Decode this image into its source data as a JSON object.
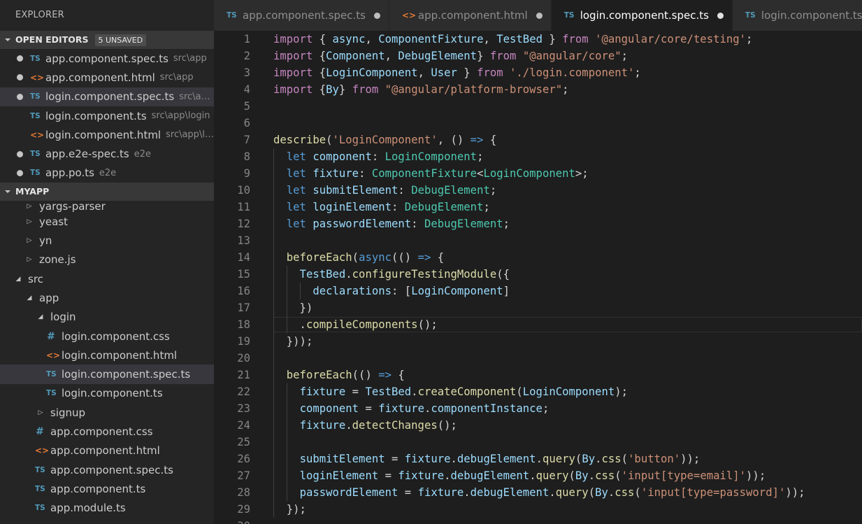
{
  "sidebar": {
    "title": "EXPLORER",
    "open_editors": {
      "label": "OPEN EDITORS",
      "badge": "5 UNSAVED",
      "items": [
        {
          "name": "app.component.spec.ts",
          "path": "src\\app",
          "type": "ts",
          "unsaved": true
        },
        {
          "name": "app.component.html",
          "path": "src\\app",
          "type": "html",
          "unsaved": true
        },
        {
          "name": "login.component.spec.ts",
          "path": "src\\app...",
          "type": "ts",
          "unsaved": true
        },
        {
          "name": "login.component.ts",
          "path": "src\\app\\login",
          "type": "ts",
          "unsaved": false
        },
        {
          "name": "login.component.html",
          "path": "src\\app\\lo...",
          "type": "html",
          "unsaved": false
        },
        {
          "name": "app.e2e-spec.ts",
          "path": "e2e",
          "type": "ts",
          "unsaved": true
        },
        {
          "name": "app.po.ts",
          "path": "e2e",
          "type": "ts",
          "unsaved": true
        }
      ]
    },
    "myapp": {
      "label": "MYAPP",
      "tree": [
        {
          "name": "yargs-parser",
          "kind": "folder",
          "expanded": false,
          "depth": 0
        },
        {
          "name": "yeast",
          "kind": "folder",
          "expanded": false,
          "depth": 0
        },
        {
          "name": "yn",
          "kind": "folder",
          "expanded": false,
          "depth": 0
        },
        {
          "name": "zone.js",
          "kind": "folder",
          "expanded": false,
          "depth": 0
        },
        {
          "name": "src",
          "kind": "folder",
          "expanded": true,
          "depth": -1
        },
        {
          "name": "app",
          "kind": "folder",
          "expanded": true,
          "depth": 0
        },
        {
          "name": "login",
          "kind": "folder",
          "expanded": true,
          "depth": 1
        },
        {
          "name": "login.component.css",
          "kind": "css",
          "depth": 2
        },
        {
          "name": "login.component.html",
          "kind": "html",
          "depth": 2
        },
        {
          "name": "login.component.spec.ts",
          "kind": "ts",
          "depth": 2,
          "selected": true
        },
        {
          "name": "login.component.ts",
          "kind": "ts",
          "depth": 2
        },
        {
          "name": "signup",
          "kind": "folder",
          "expanded": false,
          "depth": 1
        },
        {
          "name": "app.component.css",
          "kind": "css",
          "depth": 1
        },
        {
          "name": "app.component.html",
          "kind": "html",
          "depth": 1
        },
        {
          "name": "app.component.spec.ts",
          "kind": "ts",
          "depth": 1
        },
        {
          "name": "app.component.ts",
          "kind": "ts",
          "depth": 1
        },
        {
          "name": "app.module.ts",
          "kind": "ts",
          "depth": 1
        }
      ]
    }
  },
  "tabs": [
    {
      "label": "app.component.spec.ts",
      "type": "ts",
      "unsaved": true,
      "active": false
    },
    {
      "label": "app.component.html",
      "type": "html",
      "unsaved": true,
      "active": false
    },
    {
      "label": "login.component.spec.ts",
      "type": "ts",
      "unsaved": true,
      "active": true
    },
    {
      "label": "login.component.ts",
      "type": "ts",
      "unsaved": false,
      "active": false
    }
  ],
  "icons": {
    "ts": "TS",
    "html": "<>",
    "css": "#"
  },
  "colors": {
    "editor_bg": "#1e1e1e",
    "sidebar_bg": "#252526",
    "keyword": "#569cd6",
    "control": "#c586c0",
    "string": "#ce9178",
    "type": "#4ec9b0",
    "variable": "#9cdcfe",
    "function": "#dcdcaa"
  },
  "editor": {
    "current_line": 18,
    "lines": [
      {
        "n": "1",
        "t": [
          [
            "import",
            "kw2"
          ],
          [
            " { ",
            "pu"
          ],
          [
            "async",
            "va"
          ],
          [
            ", ",
            "pu"
          ],
          [
            "ComponentFixture",
            "va"
          ],
          [
            ", ",
            "pu"
          ],
          [
            "TestBed",
            "va"
          ],
          [
            " } ",
            "pu"
          ],
          [
            "from",
            "kw2"
          ],
          [
            " ",
            "pu"
          ],
          [
            "'@angular/core/testing'",
            "str"
          ],
          [
            ";",
            "pu"
          ]
        ]
      },
      {
        "n": "2",
        "t": [
          [
            "import",
            "kw2"
          ],
          [
            " {",
            "pu"
          ],
          [
            "Component",
            "va"
          ],
          [
            ", ",
            "pu"
          ],
          [
            "DebugElement",
            "va"
          ],
          [
            "} ",
            "pu"
          ],
          [
            "from",
            "kw2"
          ],
          [
            " ",
            "pu"
          ],
          [
            "\"@angular/core\"",
            "str"
          ],
          [
            ";",
            "pu"
          ]
        ]
      },
      {
        "n": "3",
        "t": [
          [
            "import",
            "kw2"
          ],
          [
            " {",
            "pu"
          ],
          [
            "LoginComponent",
            "va"
          ],
          [
            ", ",
            "pu"
          ],
          [
            "User",
            "va"
          ],
          [
            " } ",
            "pu"
          ],
          [
            "from",
            "kw2"
          ],
          [
            " ",
            "pu"
          ],
          [
            "'./login.component'",
            "str"
          ],
          [
            ";",
            "pu"
          ]
        ]
      },
      {
        "n": "4",
        "t": [
          [
            "import",
            "kw2"
          ],
          [
            " {",
            "pu"
          ],
          [
            "By",
            "va"
          ],
          [
            "} ",
            "pu"
          ],
          [
            "from",
            "kw2"
          ],
          [
            " ",
            "pu"
          ],
          [
            "\"@angular/platform-browser\"",
            "str"
          ],
          [
            ";",
            "pu"
          ]
        ]
      },
      {
        "n": "5",
        "t": []
      },
      {
        "n": "6",
        "t": []
      },
      {
        "n": "7",
        "t": [
          [
            "describe",
            "fn"
          ],
          [
            "(",
            "pu"
          ],
          [
            "'LoginComponent'",
            "str"
          ],
          [
            ", () ",
            "pu"
          ],
          [
            "=>",
            "kw"
          ],
          [
            " {",
            "pu"
          ]
        ]
      },
      {
        "n": "8",
        "t": [
          [
            "  ",
            "pu"
          ],
          [
            "let",
            "kw"
          ],
          [
            " ",
            "pu"
          ],
          [
            "component",
            "va"
          ],
          [
            ": ",
            "pu"
          ],
          [
            "LoginComponent",
            "ty"
          ],
          [
            ";",
            "pu"
          ]
        ]
      },
      {
        "n": "9",
        "t": [
          [
            "  ",
            "pu"
          ],
          [
            "let",
            "kw"
          ],
          [
            " ",
            "pu"
          ],
          [
            "fixture",
            "va"
          ],
          [
            ": ",
            "pu"
          ],
          [
            "ComponentFixture",
            "ty"
          ],
          [
            "<",
            "pu"
          ],
          [
            "LoginComponent",
            "ty"
          ],
          [
            ">;",
            "pu"
          ]
        ]
      },
      {
        "n": "10",
        "t": [
          [
            "  ",
            "pu"
          ],
          [
            "let",
            "kw"
          ],
          [
            " ",
            "pu"
          ],
          [
            "submitElement",
            "va"
          ],
          [
            ": ",
            "pu"
          ],
          [
            "DebugElement",
            "ty"
          ],
          [
            ";",
            "pu"
          ]
        ]
      },
      {
        "n": "11",
        "t": [
          [
            "  ",
            "pu"
          ],
          [
            "let",
            "kw"
          ],
          [
            " ",
            "pu"
          ],
          [
            "loginElement",
            "va"
          ],
          [
            ": ",
            "pu"
          ],
          [
            "DebugElement",
            "ty"
          ],
          [
            ";",
            "pu"
          ]
        ]
      },
      {
        "n": "12",
        "t": [
          [
            "  ",
            "pu"
          ],
          [
            "let",
            "kw"
          ],
          [
            " ",
            "pu"
          ],
          [
            "passwordElement",
            "va"
          ],
          [
            ": ",
            "pu"
          ],
          [
            "DebugElement",
            "ty"
          ],
          [
            ";",
            "pu"
          ]
        ]
      },
      {
        "n": "13",
        "t": []
      },
      {
        "n": "14",
        "t": [
          [
            "  ",
            "pu"
          ],
          [
            "beforeEach",
            "fn"
          ],
          [
            "(",
            "pu"
          ],
          [
            "async",
            "kw"
          ],
          [
            "(() ",
            "pu"
          ],
          [
            "=>",
            "kw"
          ],
          [
            " {",
            "pu"
          ]
        ]
      },
      {
        "n": "15",
        "t": [
          [
            "    ",
            "pu"
          ],
          [
            "TestBed",
            "va"
          ],
          [
            ".",
            "pu"
          ],
          [
            "configureTestingModule",
            "fn"
          ],
          [
            "({",
            "pu"
          ]
        ]
      },
      {
        "n": "16",
        "t": [
          [
            "      ",
            "pu"
          ],
          [
            "declarations",
            "va"
          ],
          [
            ": [",
            "pu"
          ],
          [
            "LoginComponent",
            "va"
          ],
          [
            "]",
            "pu"
          ]
        ]
      },
      {
        "n": "17",
        "t": [
          [
            "    })",
            "pu"
          ]
        ]
      },
      {
        "n": "18",
        "t": [
          [
            "    .",
            "pu"
          ],
          [
            "compileComponents",
            "fn"
          ],
          [
            "();",
            "pu"
          ]
        ]
      },
      {
        "n": "19",
        "t": [
          [
            "  }));",
            "pu"
          ]
        ]
      },
      {
        "n": "20",
        "t": []
      },
      {
        "n": "21",
        "t": [
          [
            "  ",
            "pu"
          ],
          [
            "beforeEach",
            "fn"
          ],
          [
            "(() ",
            "pu"
          ],
          [
            "=>",
            "kw"
          ],
          [
            " {",
            "pu"
          ]
        ]
      },
      {
        "n": "22",
        "t": [
          [
            "    ",
            "pu"
          ],
          [
            "fixture",
            "va"
          ],
          [
            " = ",
            "pu"
          ],
          [
            "TestBed",
            "va"
          ],
          [
            ".",
            "pu"
          ],
          [
            "createComponent",
            "fn"
          ],
          [
            "(",
            "pu"
          ],
          [
            "LoginComponent",
            "va"
          ],
          [
            ");",
            "pu"
          ]
        ]
      },
      {
        "n": "23",
        "t": [
          [
            "    ",
            "pu"
          ],
          [
            "component",
            "va"
          ],
          [
            " = ",
            "pu"
          ],
          [
            "fixture",
            "va"
          ],
          [
            ".",
            "pu"
          ],
          [
            "componentInstance",
            "va"
          ],
          [
            ";",
            "pu"
          ]
        ]
      },
      {
        "n": "24",
        "t": [
          [
            "    ",
            "pu"
          ],
          [
            "fixture",
            "va"
          ],
          [
            ".",
            "pu"
          ],
          [
            "detectChanges",
            "fn"
          ],
          [
            "();",
            "pu"
          ]
        ]
      },
      {
        "n": "25",
        "t": []
      },
      {
        "n": "26",
        "t": [
          [
            "    ",
            "pu"
          ],
          [
            "submitElement",
            "va"
          ],
          [
            " = ",
            "pu"
          ],
          [
            "fixture",
            "va"
          ],
          [
            ".",
            "pu"
          ],
          [
            "debugElement",
            "va"
          ],
          [
            ".",
            "pu"
          ],
          [
            "query",
            "fn"
          ],
          [
            "(",
            "pu"
          ],
          [
            "By",
            "va"
          ],
          [
            ".",
            "pu"
          ],
          [
            "css",
            "fn"
          ],
          [
            "(",
            "pu"
          ],
          [
            "'button'",
            "str"
          ],
          [
            "));",
            "pu"
          ]
        ]
      },
      {
        "n": "27",
        "t": [
          [
            "    ",
            "pu"
          ],
          [
            "loginElement",
            "va"
          ],
          [
            " = ",
            "pu"
          ],
          [
            "fixture",
            "va"
          ],
          [
            ".",
            "pu"
          ],
          [
            "debugElement",
            "va"
          ],
          [
            ".",
            "pu"
          ],
          [
            "query",
            "fn"
          ],
          [
            "(",
            "pu"
          ],
          [
            "By",
            "va"
          ],
          [
            ".",
            "pu"
          ],
          [
            "css",
            "fn"
          ],
          [
            "(",
            "pu"
          ],
          [
            "'input[type=email]'",
            "str"
          ],
          [
            "));",
            "pu"
          ]
        ]
      },
      {
        "n": "28",
        "t": [
          [
            "    ",
            "pu"
          ],
          [
            "passwordElement",
            "va"
          ],
          [
            " = ",
            "pu"
          ],
          [
            "fixture",
            "va"
          ],
          [
            ".",
            "pu"
          ],
          [
            "debugElement",
            "va"
          ],
          [
            ".",
            "pu"
          ],
          [
            "query",
            "fn"
          ],
          [
            "(",
            "pu"
          ],
          [
            "By",
            "va"
          ],
          [
            ".",
            "pu"
          ],
          [
            "css",
            "fn"
          ],
          [
            "(",
            "pu"
          ],
          [
            "'input[type=password]'",
            "str"
          ],
          [
            "));",
            "pu"
          ]
        ]
      },
      {
        "n": "29",
        "t": [
          [
            "  });",
            "pu"
          ]
        ]
      },
      {
        "n": "30",
        "t": []
      }
    ]
  }
}
